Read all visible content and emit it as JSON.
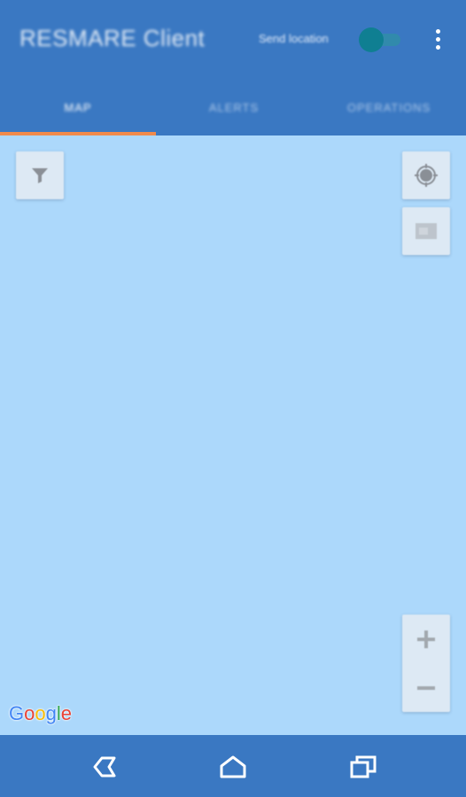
{
  "app_bar": {
    "title": "RESMARE Client",
    "send_location_label": "Send location",
    "send_location_toggle": "on",
    "overflow_icon": "more-vert-icon"
  },
  "tabs": [
    {
      "label": "MAP",
      "selected": true
    },
    {
      "label": "ALERTS",
      "selected": false
    },
    {
      "label": "OPERATIONS",
      "selected": false
    }
  ],
  "map": {
    "filter_icon": "filter-icon",
    "locate_icon": "my-location-icon",
    "layers_icon": "layers-icon",
    "zoom_in_icon": "zoom-in-icon",
    "zoom_out_icon": "zoom-out-icon",
    "attribution": {
      "letters": [
        "G",
        "o",
        "o",
        "g",
        "l",
        "e"
      ]
    }
  },
  "nav_bar": {
    "back_icon": "back-icon",
    "home_icon": "home-icon",
    "recents_icon": "recents-icon"
  },
  "colors": {
    "primary": "#3a78c2",
    "accent": "#f08a4b",
    "map_water": "#acd8fb",
    "toggle_on": "#0f7f92"
  }
}
